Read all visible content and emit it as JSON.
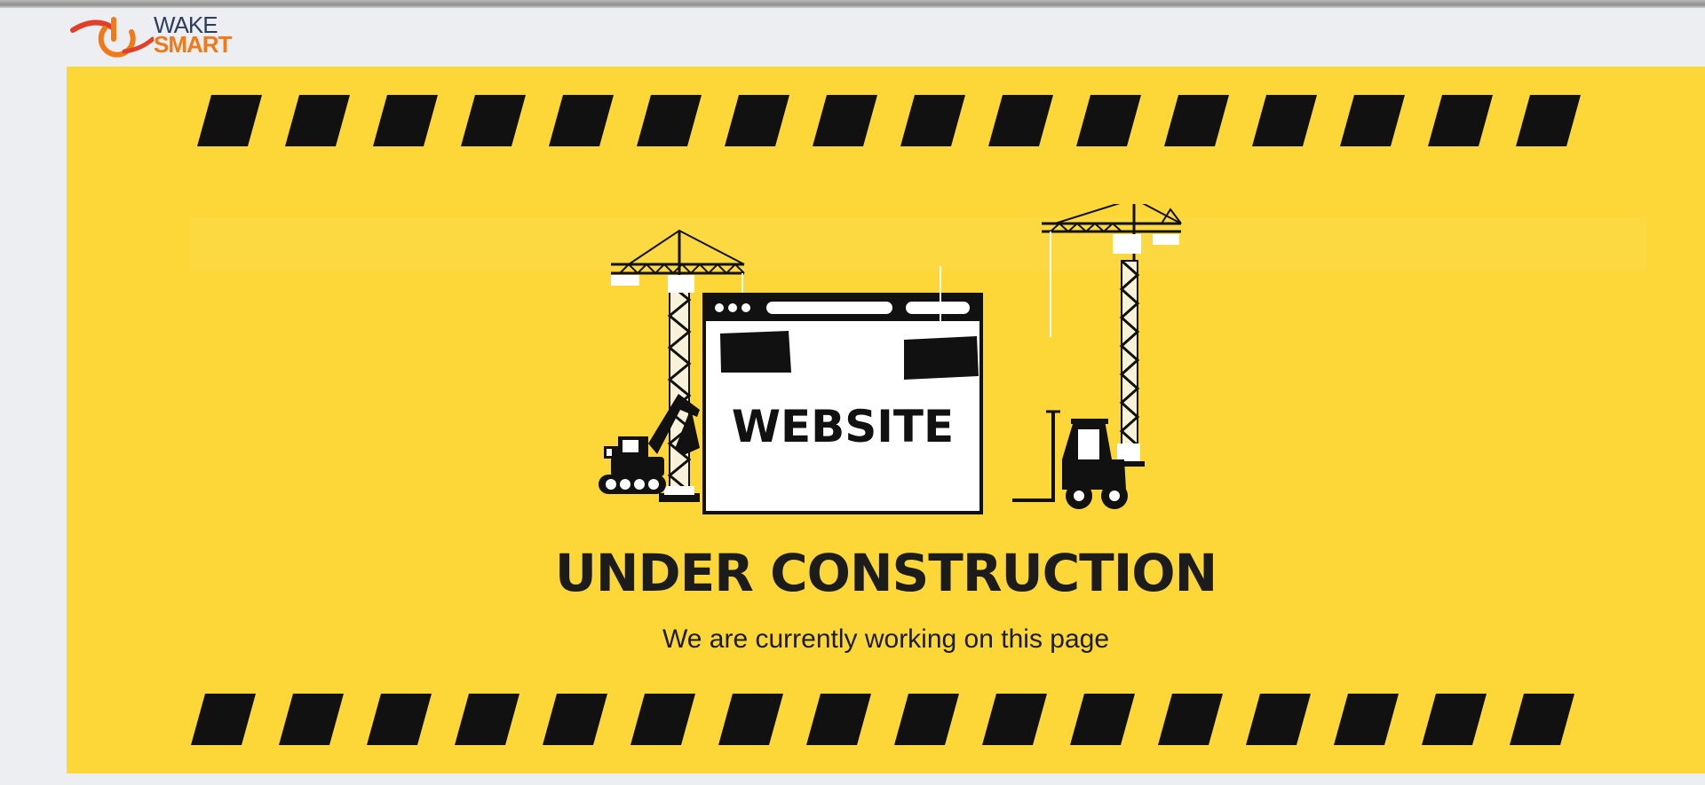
{
  "logo": {
    "wake": "WAKE",
    "smart": "SMART"
  },
  "banner": {
    "browser_label": "WEBSITE",
    "headline": "UNDER CONSTRUCTION",
    "subline": "We are currently working on this page"
  },
  "colors": {
    "banner_yellow": "#fdd737",
    "ink": "#1c1c1c",
    "logo_orange": "#f07a1a",
    "logo_navy": "#2d3e5c",
    "page_bg": "#eceef2"
  }
}
